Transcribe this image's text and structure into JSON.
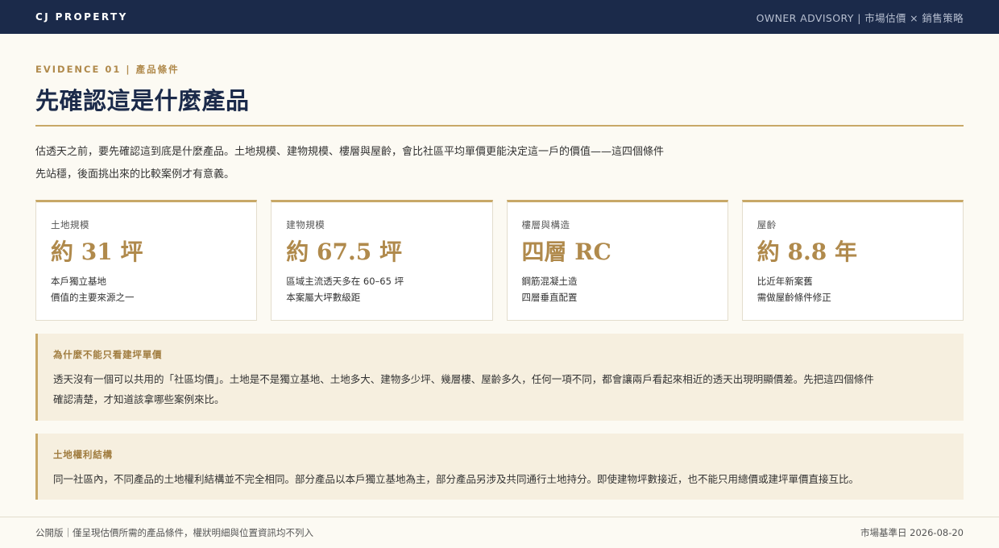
{
  "header": {
    "brand": "CJ PROPERTY",
    "nav": "OWNER ADVISORY | 市場估價 × 銷售策略"
  },
  "section": {
    "eyebrow": "EVIDENCE 01 | 產品條件",
    "title": "先確認這是什麼產品",
    "intro_line1": "估透天之前，要先確認這到底是什麼產品。土地規模、建物規模、樓層與屋齡，會比社區平均單價更能決定這一戶的價值——這四個條件",
    "intro_line2": "先站穩，後面挑出來的比較案例才有意義。"
  },
  "cards": [
    {
      "label": "土地規模",
      "value": "約 31 坪",
      "desc1": "本戶獨立基地",
      "desc2": "價值的主要來源之一"
    },
    {
      "label": "建物規模",
      "value": "約 67.5 坪",
      "desc1": "區域主流透天多在 60–65 坪",
      "desc2": "本案屬大坪數級距"
    },
    {
      "label": "樓層與構造",
      "value": "四層 RC",
      "desc1": "鋼筋混凝土造",
      "desc2": "四層垂直配置"
    },
    {
      "label": "屋齡",
      "value": "約 8.8 年",
      "desc1": "比近年新案舊",
      "desc2": "需做屋齡條件修正"
    }
  ],
  "notes": [
    {
      "title": "為什麼不能只看建坪單價",
      "line1": "透天沒有一個可以共用的「社區均價」。土地是不是獨立基地、土地多大、建物多少坪、幾層樓、屋齡多久，任何一項不同，都會讓兩戶看起來相近的透天出現明顯價差。先把這四個條件",
      "line2": "確認清楚，才知道該拿哪些案例來比。"
    },
    {
      "title": "土地權利結構",
      "line1": "同一社區內，不同產品的土地權利結構並不完全相同。部分產品以本戶獨立基地為主，部分產品另涉及共同通行土地持分。即使建物坪數接近，也不能只用總價或建坪單價直接互比。"
    }
  ],
  "footer": {
    "left": "公開版｜僅呈現估價所需的產品條件，權狀明細與位置資訊均不列入",
    "right": "市場基準日 2026-08-20"
  }
}
